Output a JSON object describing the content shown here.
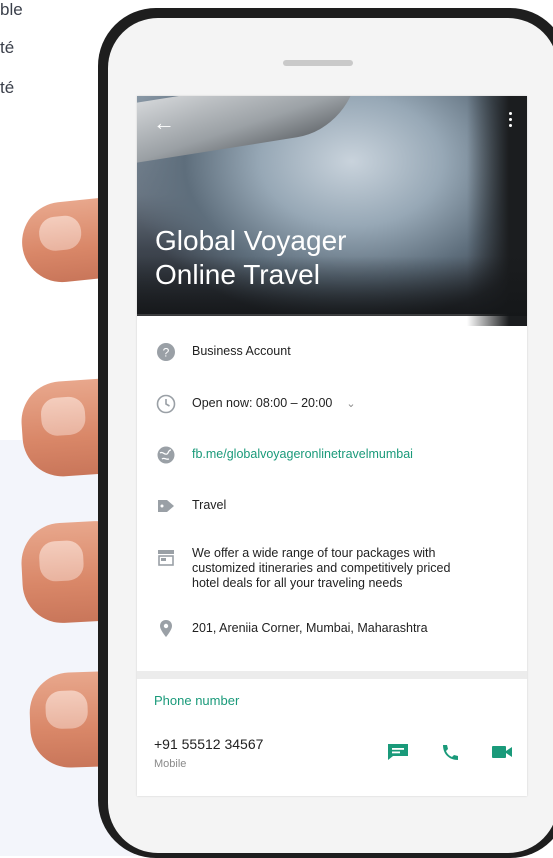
{
  "background": {
    "words": [
      "ble",
      "té",
      "té"
    ]
  },
  "screen": {
    "hero_title_line1": "Global Voyager",
    "hero_title_line2": "Online Travel",
    "rows": [
      {
        "icon": "help-circle-icon",
        "text": "Business Account"
      },
      {
        "icon": "clock-icon",
        "text": "Open now: 08:00 – 20:00",
        "has_chevron": true
      },
      {
        "icon": "globe-icon",
        "text": "fb.me/globalvoyageronlinetravelmumbai",
        "link": true
      },
      {
        "icon": "tag-icon",
        "text": "Travel"
      },
      {
        "icon": "store-icon",
        "text_lines": [
          "We offer a wide range of tour packages with",
          "customized itineraries and competitively priced",
          "hotel deals for all your traveling needs"
        ]
      },
      {
        "icon": "location-pin-icon",
        "text": "201, Areniia Corner, Mumbai, Maharashtra"
      }
    ],
    "phone_section_title": "Phone number",
    "phone_number": "+91 55512 34567",
    "phone_type": "Mobile",
    "actions": [
      {
        "icon": "message-icon",
        "label": "message"
      },
      {
        "icon": "phone-icon",
        "label": "call"
      },
      {
        "icon": "video-icon",
        "label": "video"
      }
    ]
  },
  "colors": {
    "accent": "#1a9a7a",
    "icon_grey": "#9aa0a6"
  }
}
